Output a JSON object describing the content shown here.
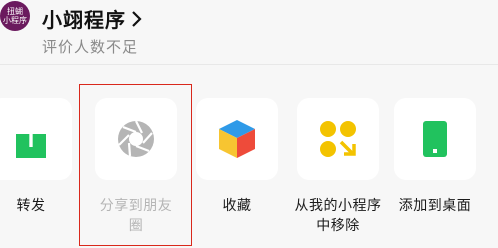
{
  "header": {
    "logo_text": "扭蝴小程序",
    "app_name": "小翊程序",
    "rating_text": "评价人数不足"
  },
  "actions": [
    {
      "label": "转发",
      "icon": "share-arrow-icon",
      "enabled": true
    },
    {
      "label": "分享到朋友圈",
      "icon": "aperture-icon",
      "enabled": false
    },
    {
      "label": "收藏",
      "icon": "cube-icon",
      "enabled": true
    },
    {
      "label": "从我的小程序中移除",
      "icon": "remove-dots-icon",
      "enabled": true
    },
    {
      "label": "添加到桌面",
      "icon": "phone-icon",
      "enabled": true
    }
  ],
  "colors": {
    "share_green": "#21c25e",
    "disabled_gray": "#b5b5b5",
    "highlight_red": "#d9281c",
    "dots_yellow": "#f3c300",
    "cube_blue": "#2f9ae8",
    "cube_red": "#ee4b3a",
    "cube_yellow": "#f7c531"
  }
}
